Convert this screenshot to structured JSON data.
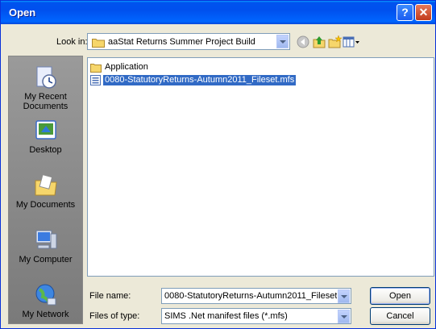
{
  "dialog": {
    "title": "Open"
  },
  "title_buttons": {
    "help": "?",
    "close": "✕"
  },
  "look_in": {
    "label": "Look in:",
    "value": "aaStat Returns Summer Project Build"
  },
  "toolbar": {
    "icons": [
      "back-icon",
      "up-one-level-icon",
      "create-new-folder-icon",
      "views-menu-icon"
    ]
  },
  "places": [
    {
      "label": "My Recent Documents",
      "icon": "recent-documents-icon"
    },
    {
      "label": "Desktop",
      "icon": "desktop-icon"
    },
    {
      "label": "My Documents",
      "icon": "my-documents-icon"
    },
    {
      "label": "My Computer",
      "icon": "my-computer-icon"
    },
    {
      "label": "My Network",
      "icon": "my-network-icon"
    }
  ],
  "files": [
    {
      "name": "Application",
      "type": "folder",
      "selected": false
    },
    {
      "name": "0080-StatutoryReturns-Autumn2011_Fileset.mfs",
      "type": "file",
      "selected": true
    }
  ],
  "file_name": {
    "label": "File name:",
    "value": "0080-StatutoryReturns-Autumn2011_Fileset.mfs"
  },
  "file_type": {
    "label": "Files of type:",
    "value": "SIMS .Net manifest files (*.mfs)"
  },
  "buttons": {
    "open": "Open",
    "cancel": "Cancel"
  },
  "colors": {
    "title_bar": "#0054e3",
    "selection": "#316ac5",
    "dialog_bg": "#ece9d8"
  }
}
